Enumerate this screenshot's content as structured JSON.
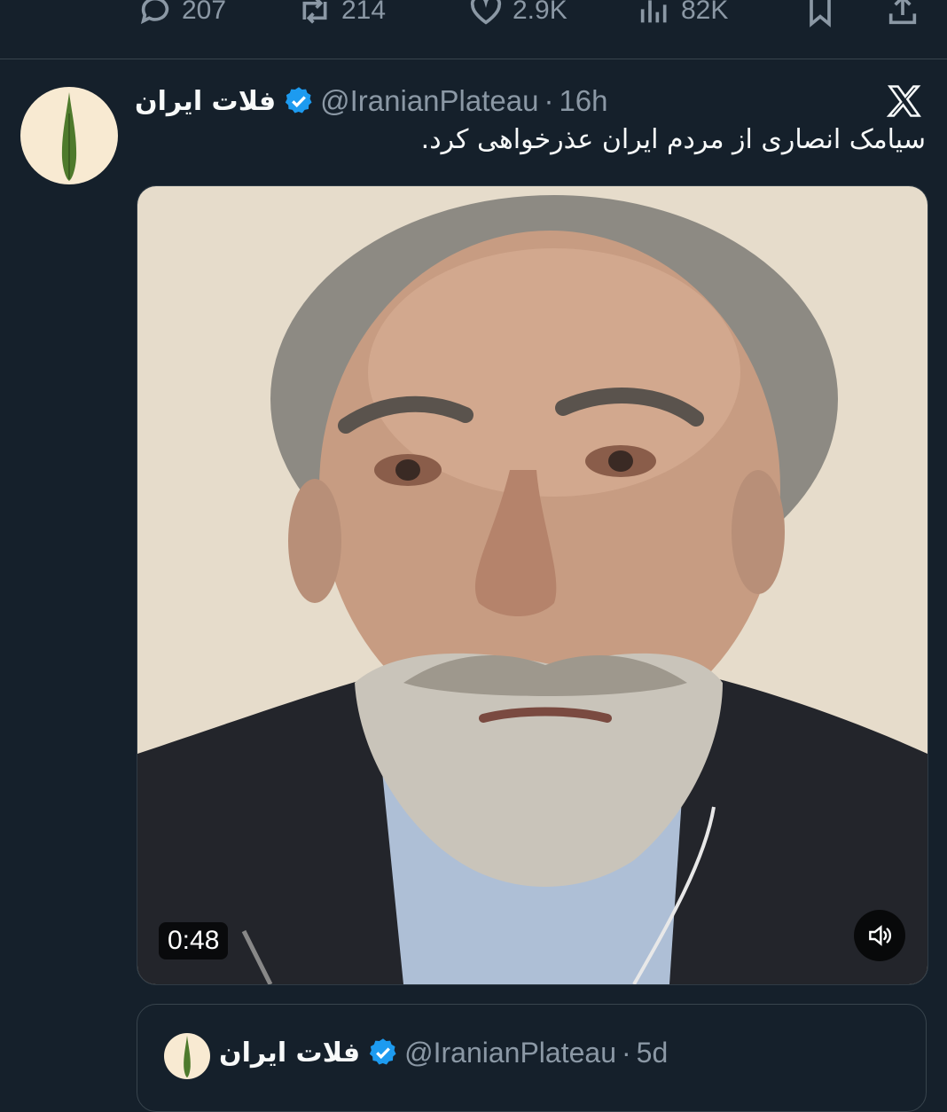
{
  "action_bar": {
    "replies": "207",
    "retweets": "214",
    "likes": "2.9K",
    "views": "82K",
    "icons": [
      "reply-icon",
      "retweet-icon",
      "like-icon",
      "views-icon",
      "bookmark-icon",
      "share-icon"
    ]
  },
  "tweet": {
    "display_name": "فلات ایران",
    "handle": "@IranianPlateau",
    "separator": "·",
    "time": "16h",
    "text": "سیامک انصاری از مردم ایران عذرخواهی کرد.",
    "media": {
      "duration": "0:48",
      "colors": {
        "background": "#e6dccb",
        "jacket": "#23252b",
        "shirt": "#aebfd6",
        "beard": "#c9c4ba"
      }
    }
  },
  "quoted_tweet": {
    "display_name": "فلات ایران",
    "handle": "@IranianPlateau",
    "separator": "·",
    "time": "5d"
  },
  "colors": {
    "background": "#15202b",
    "muted": "#8b98a5",
    "verified": "#1d9bf0",
    "avatar_bg": "#f8ead2",
    "leaf": "#4e7a2c"
  }
}
